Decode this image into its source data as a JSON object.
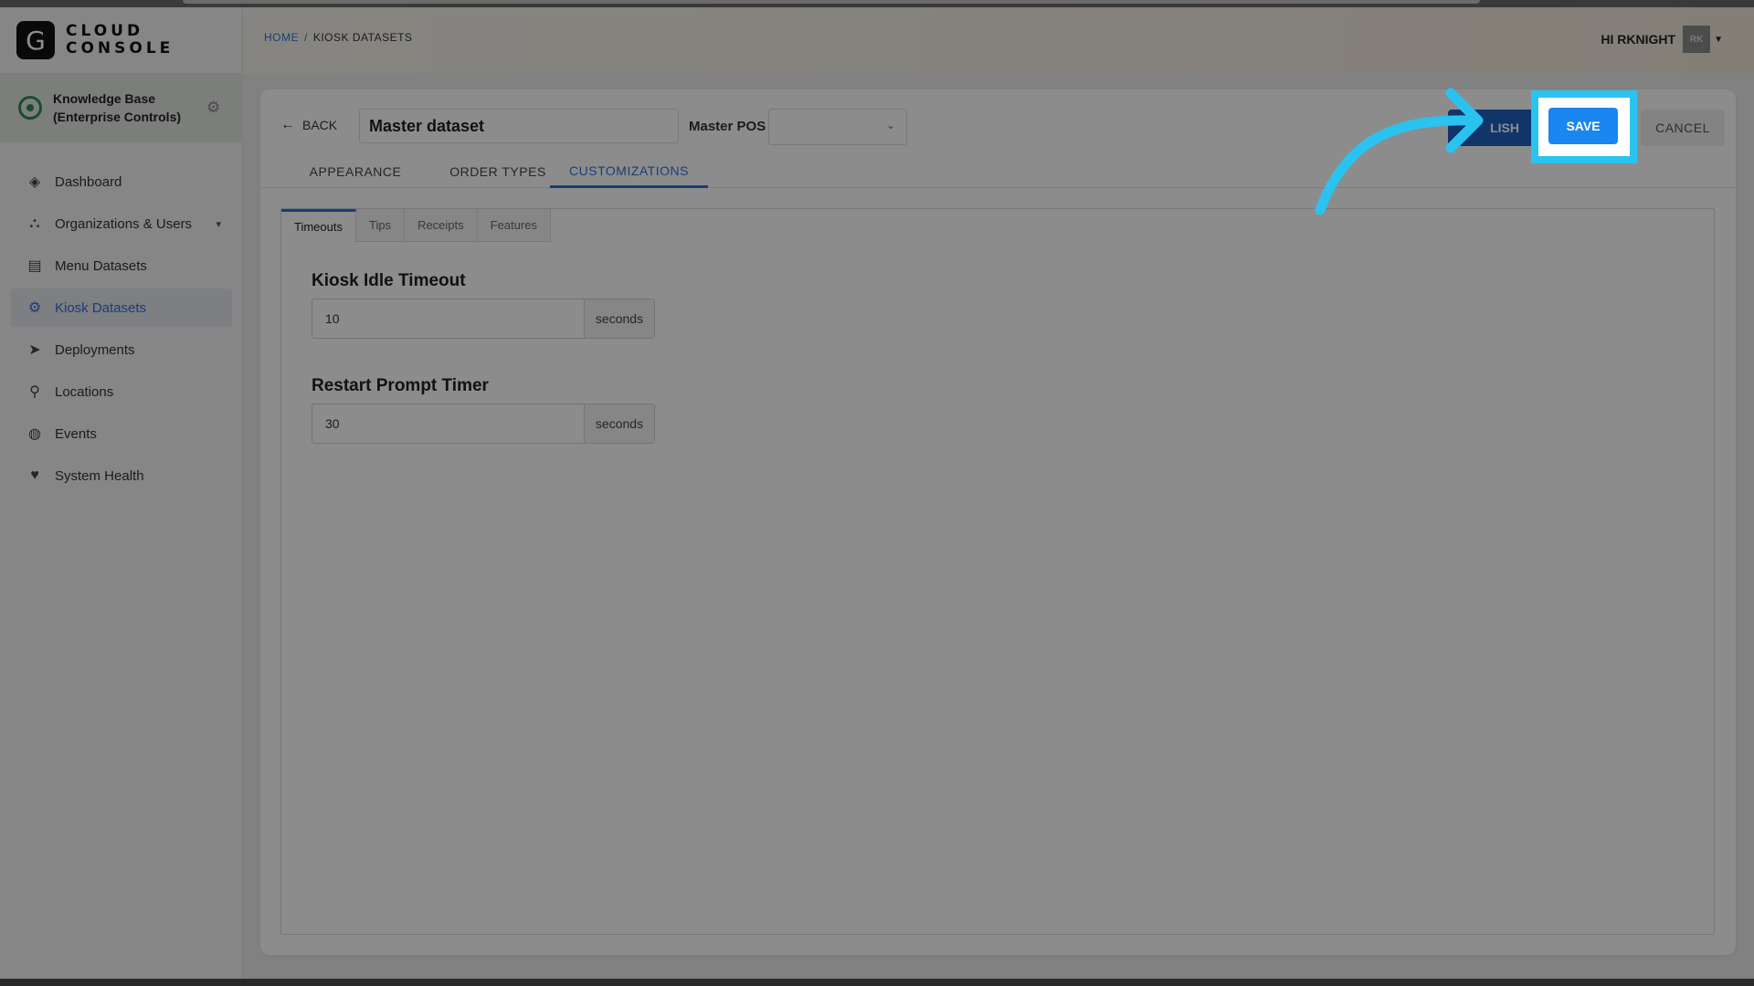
{
  "logo": {
    "mark": "G",
    "line1": "CLOUD",
    "line2": "CONSOLE"
  },
  "org": {
    "name": "Knowledge Base (Enterprise Controls)"
  },
  "nav": [
    {
      "label": "Dashboard",
      "icon": "layers-icon"
    },
    {
      "label": "Organizations & Users",
      "icon": "org-chart-icon"
    },
    {
      "label": "Menu Datasets",
      "icon": "menu-icon"
    },
    {
      "label": "Kiosk Datasets",
      "icon": "gear-icon"
    },
    {
      "label": "Deployments",
      "icon": "paper-plane-icon"
    },
    {
      "label": "Locations",
      "icon": "map-pin-icon"
    },
    {
      "label": "Events",
      "icon": "globe-icon"
    },
    {
      "label": "System Health",
      "icon": "heart-pulse-icon"
    }
  ],
  "breadcrumb": {
    "home": "HOME",
    "sep": "/",
    "current": "KIOSK DATASETS"
  },
  "user": {
    "greeting": "HI RKNIGHT",
    "initials": "RK"
  },
  "toolbar": {
    "back": "BACK",
    "dataset_name": "Master dataset",
    "pos_label": "Master POS",
    "pos_value": "",
    "publish": "LISH",
    "save": "SAVE",
    "cancel": "CANCEL"
  },
  "tabs": [
    "APPEARANCE",
    "ORDER TYPES",
    "CUSTOMIZATIONS"
  ],
  "active_tab": "CUSTOMIZATIONS",
  "subtabs": [
    "Timeouts",
    "Tips",
    "Receipts",
    "Features"
  ],
  "active_subtab": "Timeouts",
  "fields": [
    {
      "title": "Kiosk Idle Timeout",
      "value": "10",
      "unit": "seconds"
    },
    {
      "title": "Restart Prompt Timer",
      "value": "30",
      "unit": "seconds"
    }
  ],
  "colors": {
    "accent": "#2f6fd6",
    "save": "#1a86f0",
    "highlight": "#2ac3f0"
  }
}
